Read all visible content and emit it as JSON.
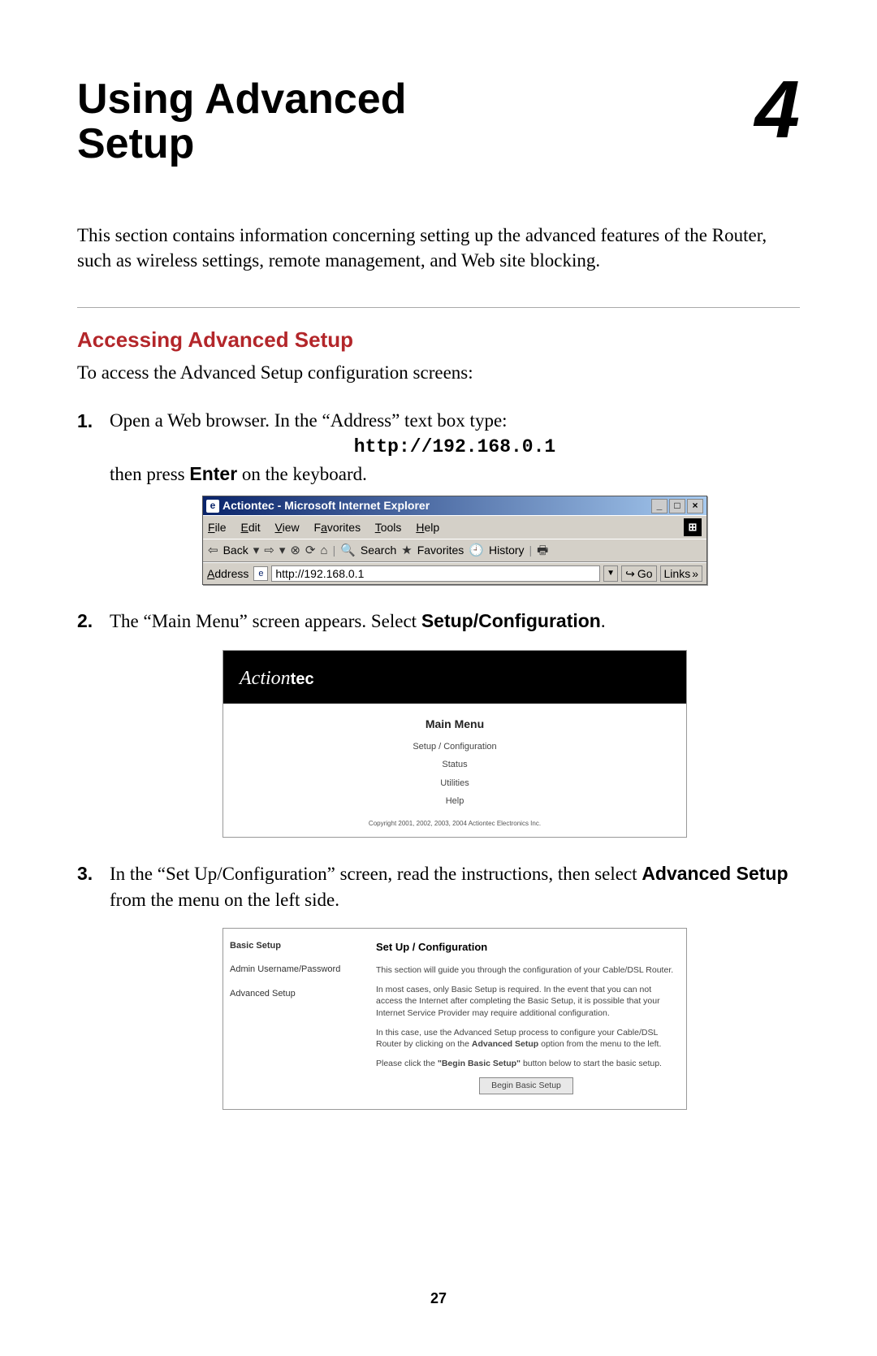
{
  "chapter": {
    "title_line1": "Using Advanced",
    "title_line2": "Setup",
    "number": "4"
  },
  "intro": "This section contains information concerning setting up the advanced features of the Router, such as wireless settings, remote management, and Web site blocking.",
  "section_heading": "Accessing Advanced Setup",
  "section_sub": "To access the Advanced Setup configuration screens:",
  "steps": {
    "s1": {
      "num": "1.",
      "text_a": "Open a Web browser. In the “Address” text box type:",
      "code": "http://192.168.0.1",
      "text_b_1": "then press ",
      "text_b_bold": "Enter",
      "text_b_2": " on the keyboard."
    },
    "s2": {
      "num": "2.",
      "text_a": "The “Main Menu” screen appears. Select ",
      "text_bold": "Setup/Configuration",
      "text_b": "."
    },
    "s3": {
      "num": "3.",
      "text_a": "In the “Set Up/Configuration” screen, read the instructions, then select ",
      "text_bold": "Advanced Setup",
      "text_b": " from the menu on the left side."
    }
  },
  "ie": {
    "title": "Actiontec - Microsoft Internet Explorer",
    "menu": {
      "file": "File",
      "edit": "Edit",
      "view": "View",
      "favorites": "Favorites",
      "tools": "Tools",
      "help": "Help"
    },
    "toolbar": {
      "back": "Back",
      "search": "Search",
      "favorites": "Favorites",
      "history": "History"
    },
    "addr": {
      "label": "Address",
      "value": "http://192.168.0.1",
      "go": "Go",
      "links": "Links"
    }
  },
  "actiontec": {
    "logo_a": "Action",
    "logo_b": "tec",
    "title": "Main Menu",
    "links": [
      "Setup / Configuration",
      "Status",
      "Utilities",
      "Help"
    ],
    "copy": "Copyright 2001, 2002, 2003, 2004 Actiontec Electronics Inc."
  },
  "cfg": {
    "sidebar": {
      "basic": "Basic Setup",
      "admin": "Admin Username/Password",
      "advanced": "Advanced Setup"
    },
    "title": "Set Up / Configuration",
    "p1": "This section will guide you through the configuration of your Cable/DSL Router.",
    "p2": "In most cases, only Basic Setup is required. In the event that you can not access the Internet after completing the Basic Setup, it is possible that your Internet Service Provider may require additional configuration.",
    "p3_a": "In this case, use the Advanced Setup process to configure your Cable/DSL Router by clicking on the ",
    "p3_bold": "Advanced Setup",
    "p3_b": " option from the menu to the left.",
    "p4_a": "Please click the ",
    "p4_bold": "\"Begin Basic Setup\"",
    "p4_b": " button below to start the basic setup.",
    "button": "Begin Basic Setup"
  },
  "page_number": "27"
}
